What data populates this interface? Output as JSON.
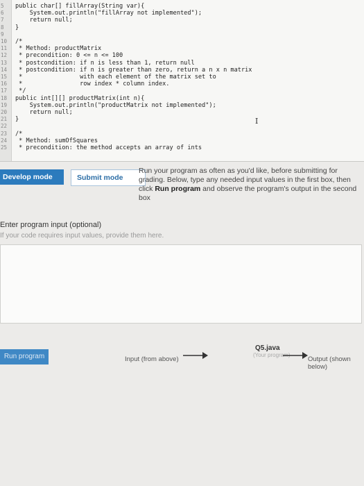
{
  "editor": {
    "lines": [
      {
        "num": "5",
        "text": "public char[] fillArray(String var){"
      },
      {
        "num": "6",
        "text": "    System.out.println(\"fillArray not implemented\");"
      },
      {
        "num": "7",
        "text": "    return null;"
      },
      {
        "num": "8",
        "text": "}"
      },
      {
        "num": "9",
        "text": ""
      },
      {
        "num": "10",
        "text": "/*"
      },
      {
        "num": "11",
        "text": " * Method: productMatrix"
      },
      {
        "num": "12",
        "text": " * precondition: 0 <= n <= 100"
      },
      {
        "num": "13",
        "text": " * postcondition: if n is less than 1, return null"
      },
      {
        "num": "14",
        "text": " * postcondition: if n is greater than zero, return a n x n matrix"
      },
      {
        "num": "15",
        "text": " *                with each element of the matrix set to"
      },
      {
        "num": "16",
        "text": " *                row index * column index."
      },
      {
        "num": "17",
        "text": " */"
      },
      {
        "num": "18",
        "text": "public int[][] productMatrix(int n){"
      },
      {
        "num": "19",
        "text": "    System.out.println(\"productMatrix not implemented\");"
      },
      {
        "num": "20",
        "text": "    return null;"
      },
      {
        "num": "21",
        "text": "}"
      },
      {
        "num": "22",
        "text": ""
      },
      {
        "num": "23",
        "text": "/*"
      },
      {
        "num": "24",
        "text": " * Method: sumOfSquares"
      },
      {
        "num": "25",
        "text": " * precondition: the method accepts an array of ints"
      }
    ]
  },
  "modes": {
    "develop": "Develop mode",
    "submit": "Submit mode"
  },
  "instructions": {
    "part1": "Run your program as often as you'd like, before submitting for grading. Below, type any needed input values in the first box, then click ",
    "bold": "Run program",
    "part2": " and observe the program's output in the second box"
  },
  "input": {
    "title": "Enter program input (optional)",
    "hint": "If your code requires input values, provide them here."
  },
  "run": {
    "button": "Run program",
    "input_from": "Input (from above)",
    "file": "Q5.java",
    "file_sub": "(Your program)",
    "output": "Output (shown below)"
  }
}
